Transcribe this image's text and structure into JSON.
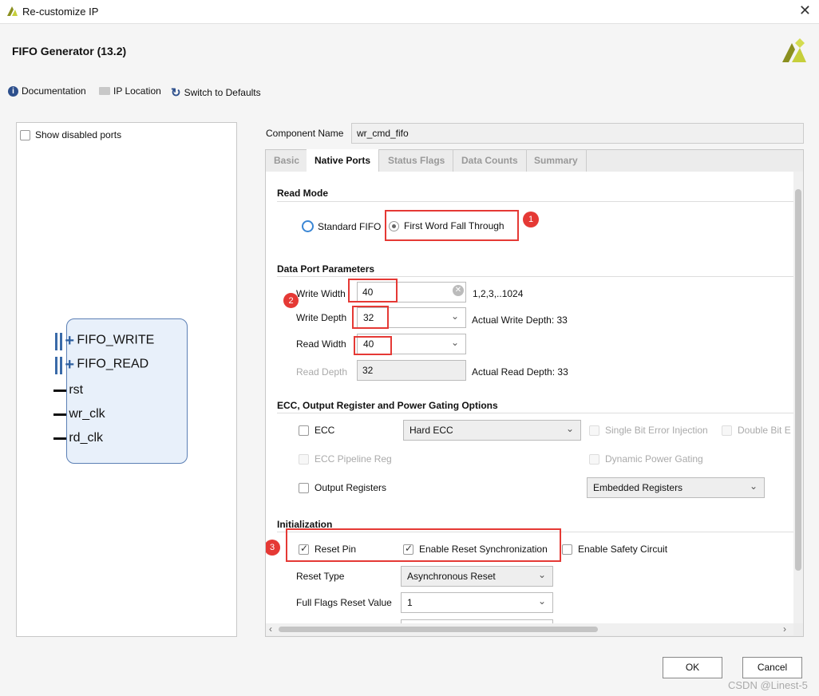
{
  "window": {
    "title": "Re-customize IP",
    "close_icon": "close-icon"
  },
  "header": {
    "title": "FIFO Generator (13.2)"
  },
  "toolbar": {
    "documentation": "Documentation",
    "ip_location": "IP Location",
    "switch_defaults": "Switch to Defaults"
  },
  "left": {
    "show_disabled": "Show disabled ports",
    "ports": [
      "FIFO_WRITE",
      "FIFO_READ",
      "rst",
      "wr_clk",
      "rd_clk"
    ]
  },
  "component": {
    "label": "Component Name",
    "value": "wr_cmd_fifo"
  },
  "tabs": [
    "Basic",
    "Native Ports",
    "Status Flags",
    "Data Counts",
    "Summary"
  ],
  "active_tab": "Native Ports",
  "read_mode": {
    "title": "Read Mode",
    "standard": "Standard FIFO",
    "fwft": "First Word Fall Through",
    "selected": "First Word Fall Through"
  },
  "data_port": {
    "title": "Data Port Parameters",
    "write_width_label": "Write Width",
    "write_width": "40",
    "write_width_range": "1,2,3,..1024",
    "write_depth_label": "Write Depth",
    "write_depth": "32",
    "actual_write_depth": "Actual Write Depth: 33",
    "read_width_label": "Read Width",
    "read_width": "40",
    "read_depth_label": "Read Depth",
    "read_depth": "32",
    "actual_read_depth": "Actual Read Depth: 33"
  },
  "ecc": {
    "title": "ECC, Output Register and Power Gating Options",
    "ecc": "ECC",
    "ecc_type": "Hard ECC",
    "single_bit": "Single Bit Error Injection",
    "double_bit": "Double Bit E",
    "ecc_pipeline": "ECC Pipeline Reg",
    "dynamic_power": "Dynamic Power Gating",
    "output_registers": "Output Registers",
    "register_type": "Embedded Registers"
  },
  "init": {
    "title": "Initialization",
    "reset_pin": "Reset Pin",
    "enable_reset_sync": "Enable Reset Synchronization",
    "enable_safety": "Enable Safety Circuit",
    "reset_type_label": "Reset Type",
    "reset_type": "Asynchronous Reset",
    "full_flags_label": "Full Flags Reset Value",
    "full_flags": "1"
  },
  "annotations": [
    "1",
    "2",
    "3"
  ],
  "buttons": {
    "ok": "OK",
    "cancel": "Cancel"
  },
  "watermark": "CSDN @Linest-5",
  "colors": {
    "highlight": "#e53935",
    "block_fill": "#e8f0fa",
    "block_border": "#5b7fb5",
    "xilinx_logo": "#c6cf3b"
  }
}
